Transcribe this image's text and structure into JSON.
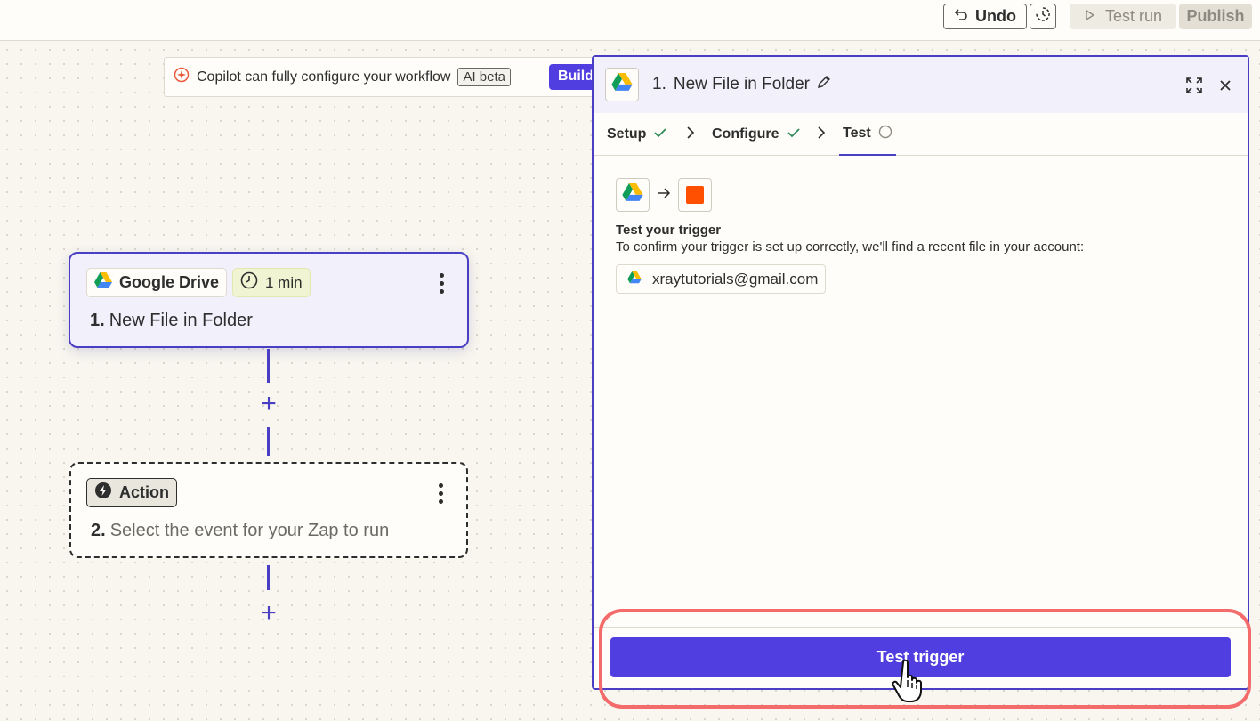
{
  "topbar": {
    "undo_label": "Undo",
    "test_run_label": "Test run",
    "publish_label": "Publish"
  },
  "copilot": {
    "text": "Copilot can fully configure your workflow",
    "badge": "AI beta",
    "build_label": "Build"
  },
  "canvas": {
    "trigger": {
      "app_name": "Google Drive",
      "time_badge": "1 min",
      "step_number": "1.",
      "title": "New File in Folder"
    },
    "action": {
      "badge": "Action",
      "step_number": "2.",
      "placeholder": "Select the event for your Zap to run"
    }
  },
  "panel": {
    "step_number": "1.",
    "title": "New File in Folder",
    "tabs": [
      {
        "label": "Setup",
        "status": "done"
      },
      {
        "label": "Configure",
        "status": "done"
      },
      {
        "label": "Test",
        "status": "pending"
      }
    ],
    "test_heading": "Test your trigger",
    "test_description": "To confirm your trigger is set up correctly, we'll find a recent file in your account:",
    "account_email": "xraytutorials@gmail.com",
    "test_button_label": "Test trigger"
  },
  "colors": {
    "accent": "#503ee0",
    "border_accent": "#4a3fc4",
    "highlight": "#f36b6b",
    "check": "#2e8b57",
    "zapier_orange": "#ff4f00"
  },
  "icons": [
    "undo-icon",
    "history-icon",
    "play-icon",
    "copilot-icon",
    "google-drive-icon",
    "clock-icon",
    "kebab-menu-icon",
    "plus-icon",
    "bolt-icon",
    "pencil-icon",
    "expand-icon",
    "close-icon",
    "check-icon",
    "chevron-right-icon",
    "pending-circle-icon",
    "arrow-right-icon",
    "hand-pointer-icon"
  ]
}
